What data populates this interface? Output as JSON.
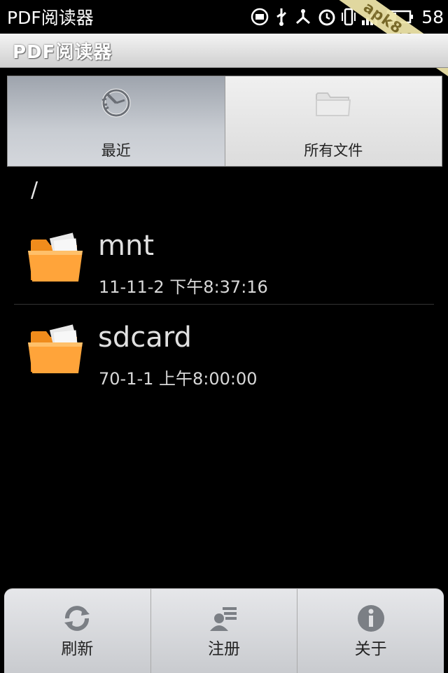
{
  "status_bar": {
    "app_name": "PDF阅读器",
    "time": "58",
    "icons": [
      "bbm-icon",
      "usb-icon",
      "debug-icon",
      "alarm-icon",
      "vibrate-icon",
      "signal-icon",
      "battery-icon"
    ]
  },
  "watermark": {
    "text": "apk8.com"
  },
  "title_bar": {
    "title": "PDF阅读器"
  },
  "tabs": [
    {
      "label": "最近",
      "icon": "recent-clock-icon",
      "active": true
    },
    {
      "label": "所有文件",
      "icon": "folder-icon",
      "active": false
    }
  ],
  "path": "/",
  "files": [
    {
      "name": "mnt",
      "date": "11-11-2 下午8:37:16"
    },
    {
      "name": "sdcard",
      "date": "70-1-1 上午8:00:00"
    }
  ],
  "menu": [
    {
      "label": "刷新",
      "icon": "refresh-icon"
    },
    {
      "label": "注册",
      "icon": "register-icon"
    },
    {
      "label": "关于",
      "icon": "info-icon"
    }
  ],
  "colors": {
    "folder": "#ffa33a",
    "tab_active": "#b7bcc4",
    "menu_bg": "#d8d9dc"
  }
}
